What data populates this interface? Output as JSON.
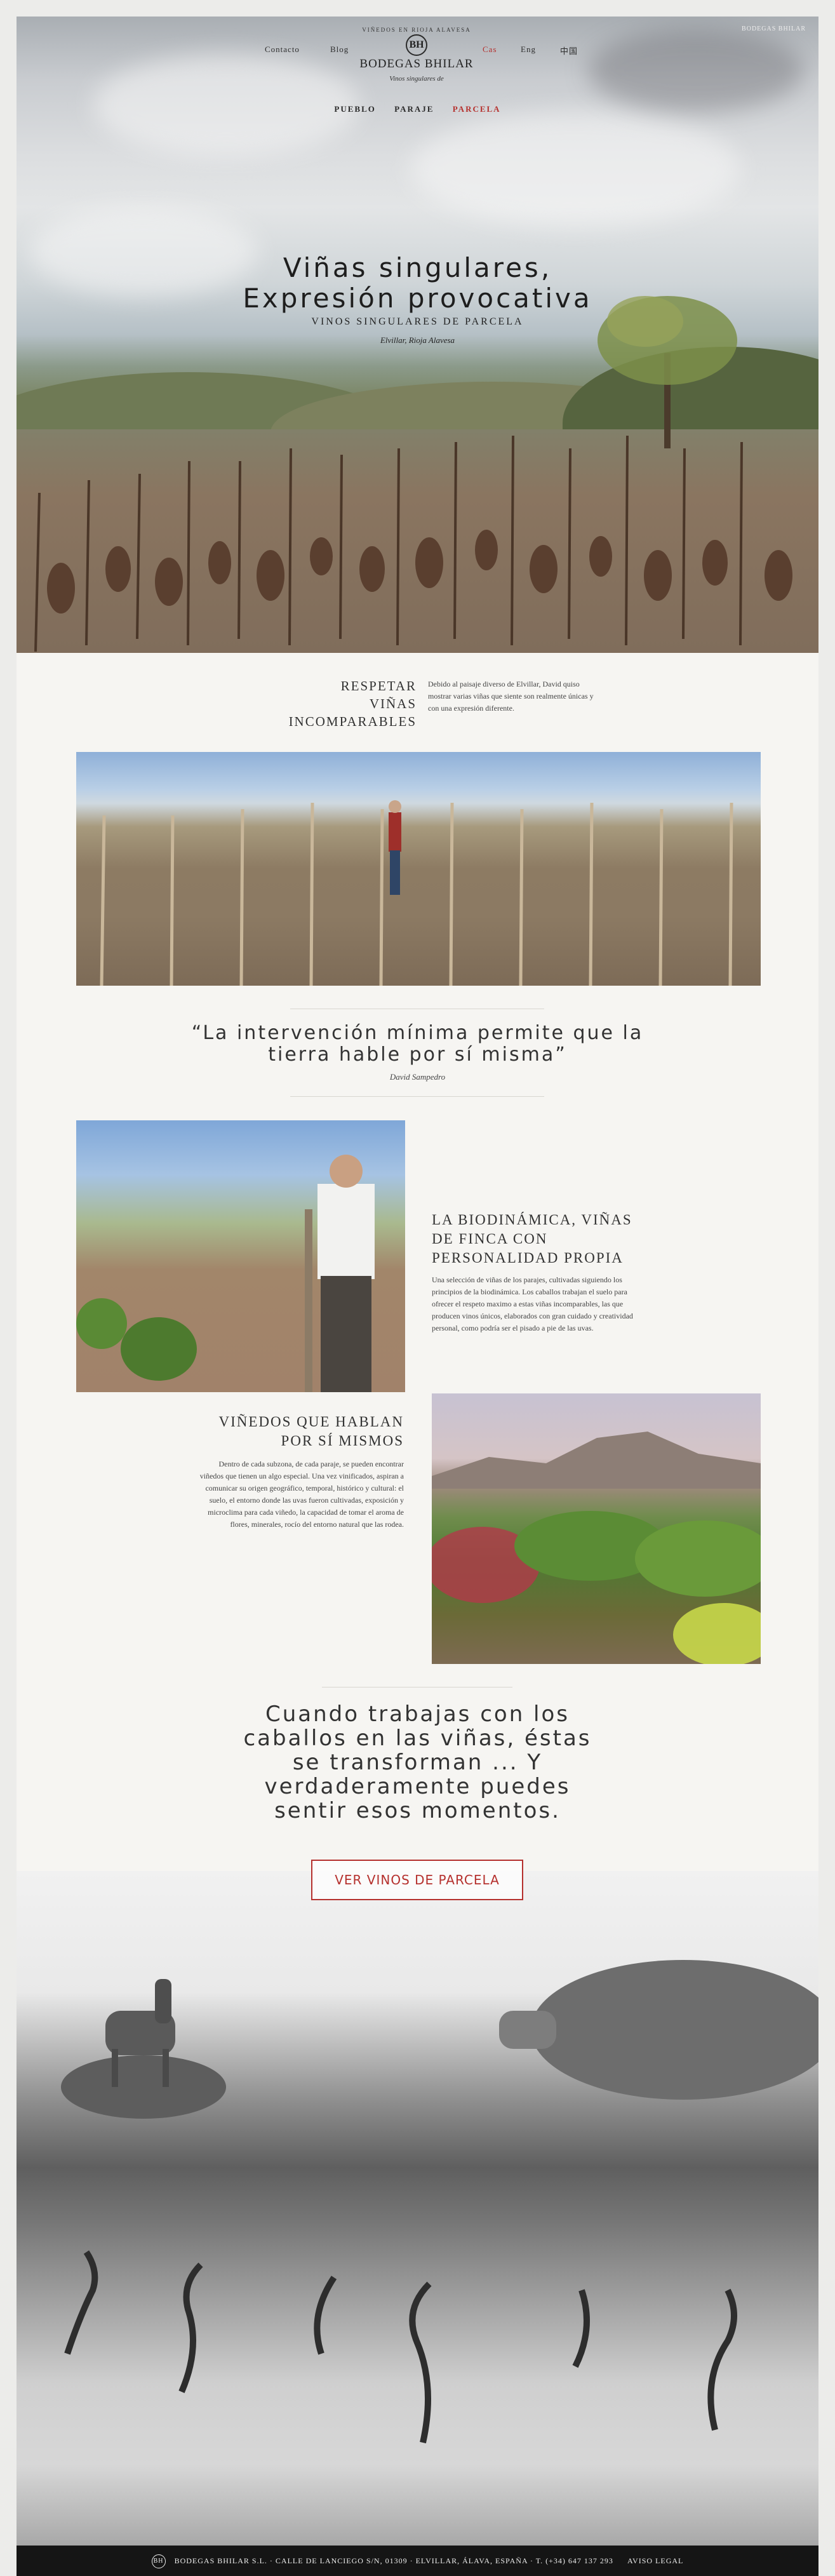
{
  "nav": {
    "contacto": "Contacto",
    "blog": "Blog",
    "cas": "Cas",
    "eng": "Eng",
    "zh": "中国",
    "top_right": "BODEGAS BHILAR"
  },
  "logo": {
    "arc_text": "VIÑEDOS EN RIOJA ALAVESA",
    "monogram": "BH",
    "brand": "BODEGAS BHILAR",
    "tagline": "Vinos singulares de"
  },
  "subnav": {
    "pueblo": "PUEBLO",
    "paraje": "PARAJE",
    "parcela": "PARCELA"
  },
  "hero": {
    "title_line1": "Viñas singulares,",
    "title_line2": "Expresión provocativa",
    "subtitle": "VINOS SINGULARES DE PARCELA",
    "location": "Elvillar, Rioja Alavesa"
  },
  "section1": {
    "heading_line1": "RESPETAR",
    "heading_line2": "VIÑAS",
    "heading_line3": "INCOMPARABLES",
    "paragraph": "Debido al paisaje diverso de Elvillar, David quiso mostrar varias viñas que siente son realmente únicas y con una expresión diferente."
  },
  "quote": {
    "line1": "“La intervención mínima permite que la",
    "line2": "tierra hable por sí misma”",
    "author": "David Sampedro"
  },
  "bio": {
    "heading_line1": "LA BIODINÁMICA, VIÑAS",
    "heading_line2": "DE FINCA CON",
    "heading_line3": "PERSONALIDAD PROPIA",
    "paragraph": "Una selección de viñas de los parajes, cultivadas siguiendo los principios de la biodinámica. Los caballos trabajan el suelo para ofrecer el respeto maximo a estas viñas incomparables, las que producen vinos únicos, elaborados con gran cuidado y creatividad personal, como podría ser el pisado a pie de las uvas."
  },
  "vinedos": {
    "heading_line1": "VIÑEDOS QUE HABLAN",
    "heading_line2": "POR SÍ MISMOS",
    "paragraph": "Dentro de cada subzona, de cada paraje, se pueden encontrar viñedos que tienen un algo especial. Una vez vinificados, aspiran a comunicar su origen geográfico, temporal, histórico y cultural: el suelo, el entorno donde las uvas fueron cultivadas, exposición y microclima para cada viñedo, la capacidad de tomar el aroma de flores, minerales, rocío del entorno natural que las rodea."
  },
  "cta": {
    "line1": "Cuando trabajas con los",
    "line2": "caballos en las viñas, éstas",
    "line3": "se transforman ... Y",
    "line4": "verdaderamente puedes",
    "line5": "sentir esos momentos.",
    "button": "VER VINOS DE PARCELA"
  },
  "footer": {
    "monogram": "BH",
    "text": "BODEGAS BHILAR S.L. · CALLE DE LANCIEGO S/N, 01309 · ELVILLAR, ÁLAVA, ESPAÑA · T. (+34) 647 137 293",
    "legal": "AVISO LEGAL"
  },
  "colors": {
    "accent": "#b5312e",
    "footer_bg": "#151515",
    "page_bg": "#f6f5f2"
  }
}
